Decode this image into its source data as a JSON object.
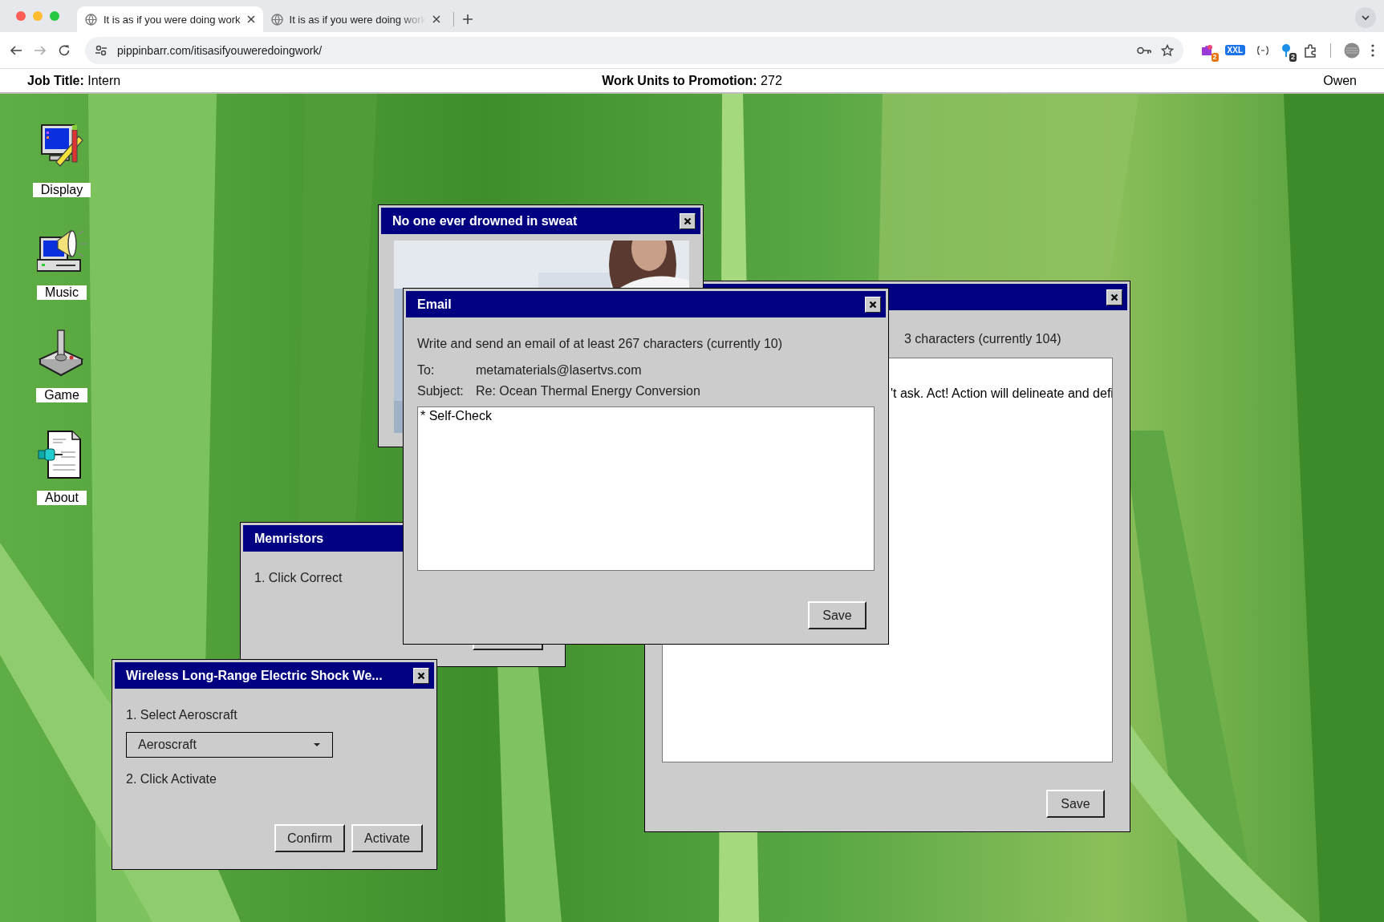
{
  "browser": {
    "tabs": [
      {
        "title": "It is as if you were doing work",
        "selected": true
      },
      {
        "title": "It is as if you were doing work",
        "selected": false
      }
    ],
    "address": "pippinbarr.com/itisasifyouweredoingwork/",
    "extensions": [
      {
        "kind": "puzzle",
        "badge": "2"
      },
      {
        "kind": "xxl",
        "badge": "XXL"
      },
      {
        "kind": "braces"
      },
      {
        "kind": "pin",
        "badge": "2"
      },
      {
        "kind": "extensions"
      }
    ]
  },
  "top_bar": {
    "job_title_label": "Job Title:",
    "job_title": "Intern",
    "units_label": "Work Units to Promotion:",
    "units": "272",
    "user": "Owen"
  },
  "desktop_icons": [
    {
      "kind": "display",
      "label": "Display"
    },
    {
      "kind": "music",
      "label": "Music"
    },
    {
      "kind": "game",
      "label": "Game"
    },
    {
      "kind": "about",
      "label": "About"
    }
  ],
  "windows": [
    {
      "kind": "email",
      "close_button": true,
      "instruction": "3 characters (currently 104)",
      "body": "'t ask. Act! Action will delineate and defi",
      "buttons": [
        "Save"
      ]
    },
    {
      "kind": "picture",
      "close_button": true,
      "title": "No one ever drowned in sweat"
    },
    {
      "kind": "task",
      "close_button": false,
      "title": "Memristors",
      "items": [
        {
          "kind": "text",
          "text": "1. Click Correct"
        }
      ],
      "covered_button": true
    },
    {
      "kind": "email",
      "close_button": true,
      "title": "Email",
      "instruction": "Write and send an email of at least 267 characters (currently 10)",
      "to_label": "To:",
      "to": "metamaterials@lasertvs.com",
      "subject_label": "Subject:",
      "subject": "Re: Ocean Thermal Energy Conversion",
      "body": "* Self-Check",
      "buttons": [
        "Save"
      ]
    },
    {
      "kind": "task",
      "close_button": true,
      "title": "Wireless Long-Range Electric Shock We...",
      "items": [
        {
          "kind": "text",
          "text": "1. Select Aeroscraft"
        },
        {
          "kind": "select",
          "value": "Aeroscraft"
        },
        {
          "kind": "text",
          "text": "2. Click Activate"
        }
      ],
      "buttons": [
        "Confirm",
        "Activate"
      ]
    }
  ]
}
